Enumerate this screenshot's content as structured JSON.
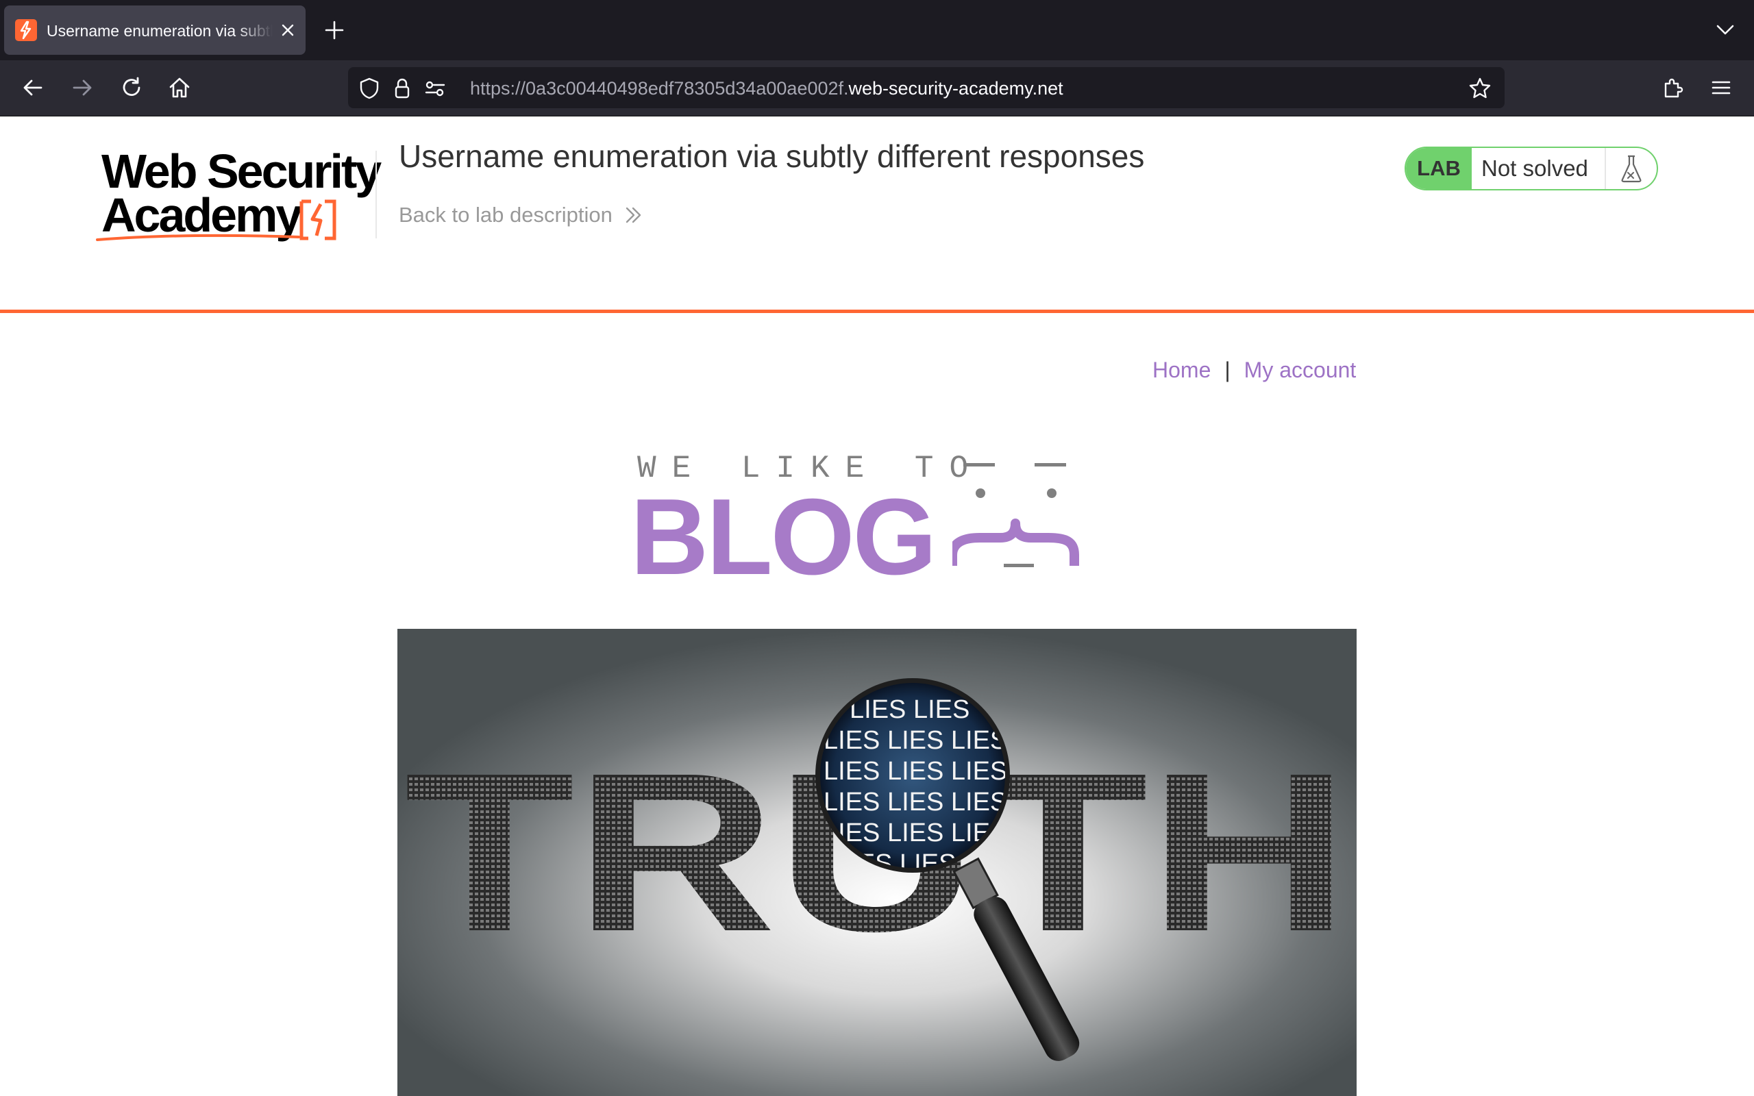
{
  "browser": {
    "tab_title": "Username enumeration via subtly different responses",
    "url_dim": "https://0a3c00440498edf78305d34a00ae002f.",
    "url_domain": "web-security-academy.net"
  },
  "header": {
    "logo_line1": "Web Security",
    "logo_line2": "Academy",
    "lab_title": "Username enumeration via subtly different responses",
    "back_link": "Back to lab description",
    "lab_badge": "LAB",
    "lab_state": "Not solved"
  },
  "nav": {
    "home": "Home",
    "separator": "|",
    "my_account": "My account"
  },
  "banner": {
    "tagline": "WE LIKE TO",
    "blog": "BLOG"
  },
  "hero": {
    "word": "TRUTH",
    "lens_lines": [
      "LIES LIES",
      "LIES LIES LIES L",
      "LIES LIES LIES LI",
      "LIES LIES LIES LI",
      "LIES LIES LIES L",
      "LIES LIES LIES"
    ]
  },
  "colors": {
    "accent_orange": "#ff6633",
    "link_purple": "#9d72c5",
    "lab_green": "#70d16d"
  }
}
